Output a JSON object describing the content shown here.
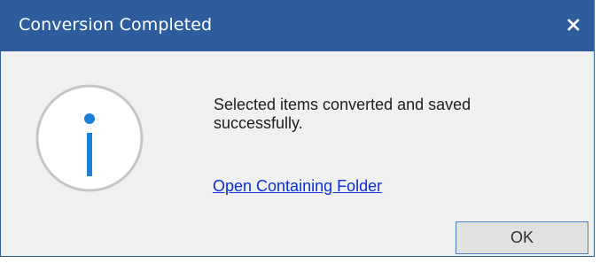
{
  "dialog": {
    "title": "Conversion Completed",
    "close_icon": "close-icon",
    "icon": "info-icon",
    "message_line1": "Selected items converted and saved",
    "message_line2": "successfully.",
    "link_text": "Open Containing Folder",
    "ok_label": "OK"
  },
  "colors": {
    "title_bar": "#2e5d9e",
    "body": "#f0f0f0",
    "link": "#0b2ed8",
    "icon_blue": "#1e7fd6",
    "icon_ring": "#c6c6c6"
  }
}
